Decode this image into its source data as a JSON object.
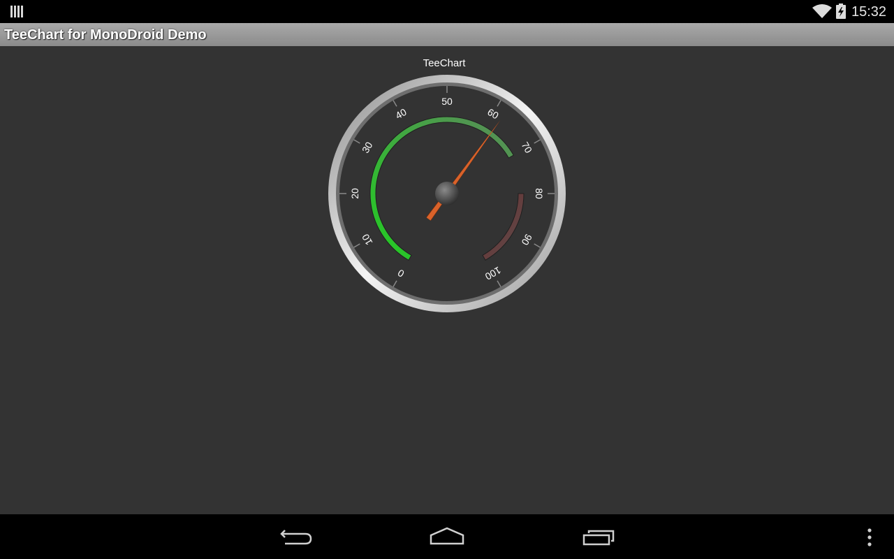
{
  "status_bar": {
    "time": "15:32",
    "icons": [
      "notification-icon",
      "wifi-icon",
      "battery-icon"
    ]
  },
  "action_bar": {
    "title": "TeeChart for MonoDroid Demo"
  },
  "chart_data": {
    "type": "gauge",
    "title": "TeeChart",
    "min": 0,
    "max": 100,
    "tick_labels": [
      "0",
      "10",
      "20",
      "30",
      "40",
      "50",
      "60",
      "70",
      "80",
      "90",
      "100"
    ],
    "needle_value": 62,
    "bands": [
      {
        "name": "green-band",
        "from": 0,
        "to": 70,
        "color_start": "#22cc22",
        "color_end": "#5a8a5a"
      },
      {
        "name": "red-band",
        "from": 80,
        "to": 100,
        "color_start": "#6a2e2e",
        "color_end": "#5e4d4d"
      }
    ],
    "colors": {
      "needle": "#d9622a",
      "bezel": "#d7d7d7",
      "face": "#333333"
    }
  },
  "nav_bar": {
    "buttons": [
      "back-icon",
      "home-icon",
      "recents-icon",
      "overflow-menu-icon"
    ]
  }
}
